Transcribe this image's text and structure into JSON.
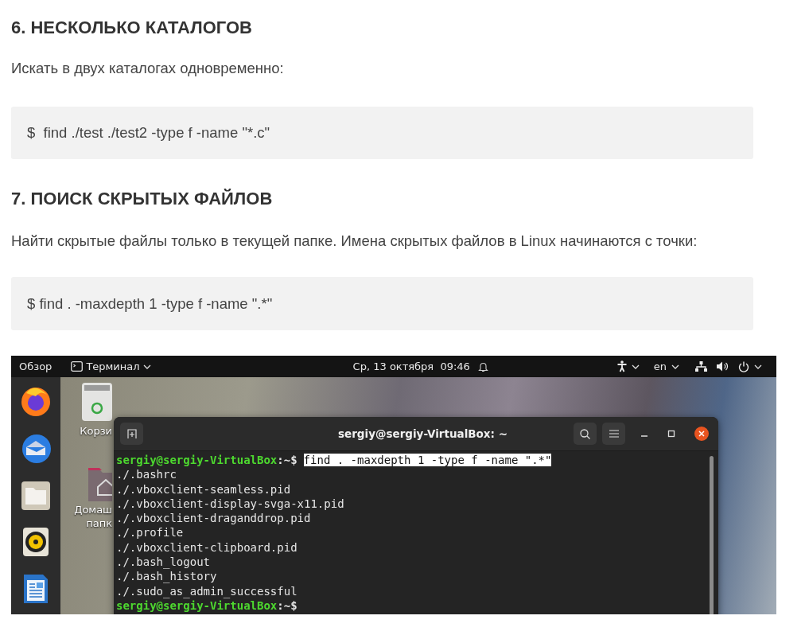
{
  "article": {
    "sections": [
      {
        "heading": "6. НЕСКОЛЬКО КАТАЛОГОВ",
        "text": "Искать в двух каталогах одновременно:",
        "code": "$  find ./test ./test2 -type f -name \"*.c\""
      },
      {
        "heading": "7. ПОИСК СКРЫТЫХ ФАЙЛОВ",
        "text": "Найти скрытые файлы только в текущей папке. Имена скрытых файлов в Linux начинаются с точки:",
        "code": "$ find . -maxdepth 1 -type f -name \".*\""
      }
    ]
  },
  "screenshot": {
    "top_bar": {
      "activities": "Обзор",
      "app_menu": "Терминал",
      "clock": "Ср, 13 октября  09:46",
      "keyboard_layout": "en"
    },
    "desktop_icons": [
      {
        "kind": "trash",
        "label_lines": [
          "Корзи"
        ]
      },
      {
        "kind": "home",
        "label_lines": [
          "Домаш",
          "папк"
        ]
      }
    ],
    "terminal": {
      "title": "sergiy@sergiy-VirtualBox: ~",
      "lines": [
        {
          "kind": "prompt",
          "user": "sergiy@sergiy-VirtualBox",
          "tail": ":~$",
          "command": "find . -maxdepth 1 -type f -name \".*\"",
          "highlighted": true
        },
        {
          "kind": "output",
          "text": "./.bashrc"
        },
        {
          "kind": "output",
          "text": "./.vboxclient-seamless.pid"
        },
        {
          "kind": "output",
          "text": "./.vboxclient-display-svga-x11.pid"
        },
        {
          "kind": "output",
          "text": "./.vboxclient-draganddrop.pid"
        },
        {
          "kind": "output",
          "text": "./.profile"
        },
        {
          "kind": "output",
          "text": "./.vboxclient-clipboard.pid"
        },
        {
          "kind": "output",
          "text": "./.bash_logout"
        },
        {
          "kind": "output",
          "text": "./.bash_history"
        },
        {
          "kind": "output",
          "text": "./.sudo_as_admin_successful"
        },
        {
          "kind": "prompt",
          "user": "sergiy@sergiy-VirtualBox",
          "tail": ":~$"
        }
      ]
    }
  }
}
